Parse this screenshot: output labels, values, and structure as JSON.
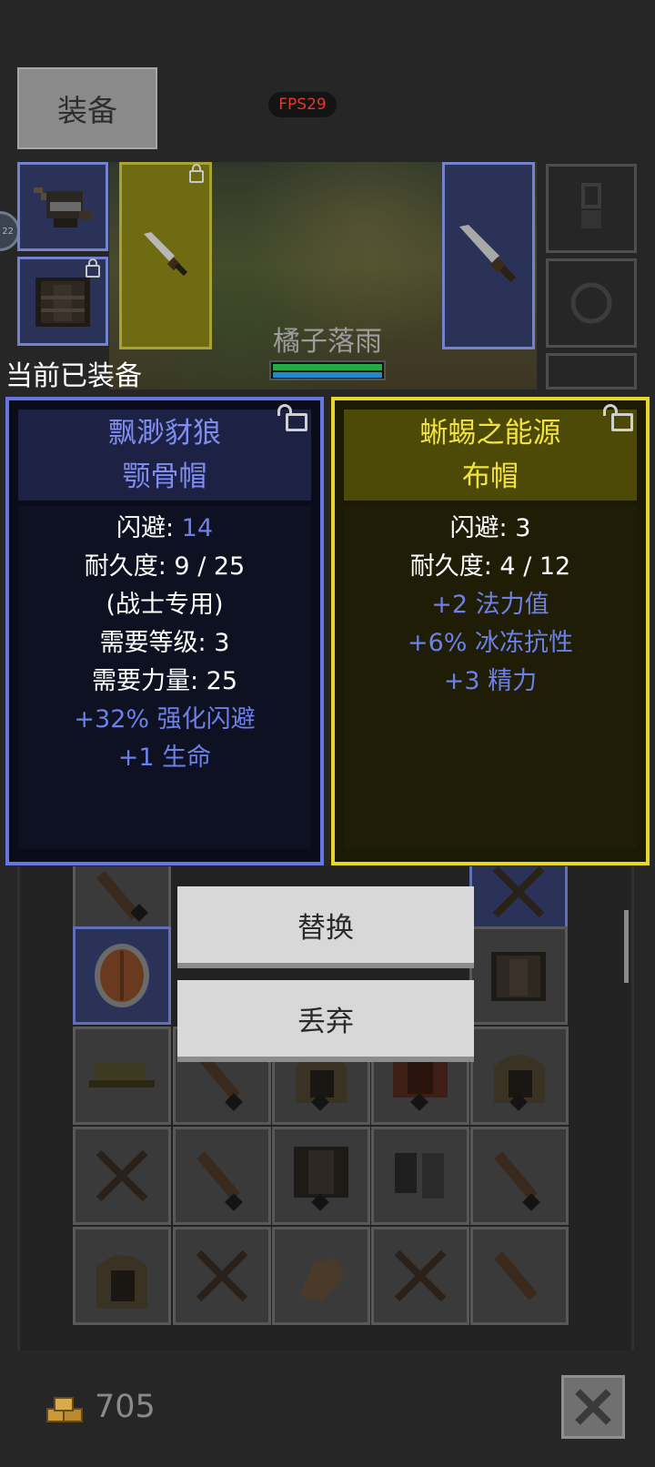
{
  "header": {
    "equip_tab_label": "装备",
    "fps_label": "FPS29",
    "side_badge_text": "22"
  },
  "character": {
    "name": "橘子落雨"
  },
  "equipped_label": "当前已装备",
  "compare": {
    "equipped": {
      "name_line1": "飘渺豺狼",
      "name_line2": "颚骨帽",
      "stats": [
        {
          "label": "闪避: ",
          "value": "14"
        },
        {
          "text": "耐久度: 9 / 25"
        },
        {
          "text": "(战士专用)"
        },
        {
          "text": "需要等级: 3"
        },
        {
          "text": "需要力量: 25"
        }
      ],
      "bonuses": [
        "+32% 强化闪避",
        "+1 生命"
      ]
    },
    "new_item": {
      "name_line1": "蜥蜴之能源",
      "name_line2": "布帽",
      "stats": [
        {
          "text": "闪避: 3"
        },
        {
          "text": "耐久度: 4 / 12"
        }
      ],
      "bonuses": [
        "+2 法力值",
        "+6% 冰冻抗性",
        "+3 精力"
      ]
    }
  },
  "actions": {
    "replace_label": "替换",
    "discard_label": "丢弃"
  },
  "footer": {
    "gold_amount": "705"
  },
  "colors": {
    "equipped_border": "#6776e0",
    "new_item_border": "#e7d72a",
    "bonus_text": "#6c80e8",
    "fps_text": "#e03a2e"
  }
}
